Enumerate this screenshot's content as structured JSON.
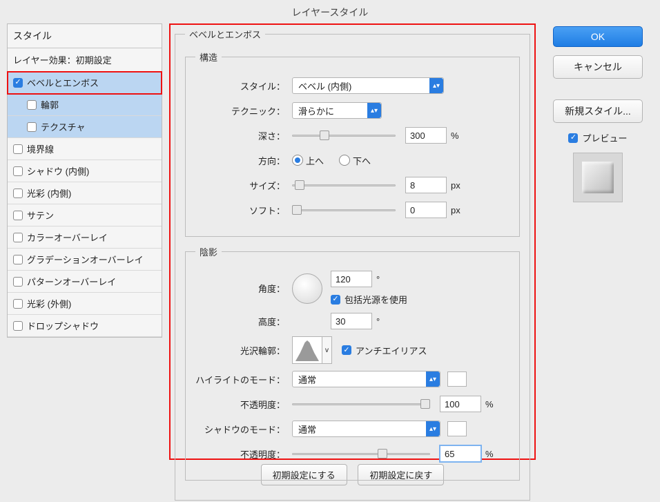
{
  "title": "レイヤースタイル",
  "left": {
    "header": "スタイル",
    "sub": "レイヤー効果：初期設定",
    "items": [
      {
        "label": "ベベルとエンボス",
        "checked": true,
        "selected": true,
        "highlight": true
      },
      {
        "label": "輪郭",
        "checked": false,
        "selected": true,
        "indent": true
      },
      {
        "label": "テクスチャ",
        "checked": false,
        "selected": true,
        "indent": true
      },
      {
        "label": "境界線",
        "checked": false
      },
      {
        "label": "シャドウ (内側)",
        "checked": false
      },
      {
        "label": "光彩 (内側)",
        "checked": false
      },
      {
        "label": "サテン",
        "checked": false
      },
      {
        "label": "カラーオーバーレイ",
        "checked": false
      },
      {
        "label": "グラデーションオーバーレイ",
        "checked": false
      },
      {
        "label": "パターンオーバーレイ",
        "checked": false
      },
      {
        "label": "光彩 (外側)",
        "checked": false
      },
      {
        "label": "ドロップシャドウ",
        "checked": false
      }
    ]
  },
  "center": {
    "section_title": "ベベルとエンボス",
    "structure": {
      "legend": "構造",
      "style_label": "スタイル：",
      "style_value": "ベベル (内側)",
      "technique_label": "テクニック：",
      "technique_value": "滑らかに",
      "depth_label": "深さ：",
      "depth_value": "300",
      "depth_unit": "%",
      "direction_label": "方向：",
      "dir_up": "上へ",
      "dir_down": "下へ",
      "size_label": "サイズ：",
      "size_value": "8",
      "size_unit": "px",
      "soft_label": "ソフト：",
      "soft_value": "0",
      "soft_unit": "px"
    },
    "shading": {
      "legend": "陰影",
      "angle_label": "角度：",
      "angle_value": "120",
      "deg": "°",
      "global_light": "包括光源を使用",
      "altitude_label": "高度：",
      "altitude_value": "30",
      "contour_label": "光沢輪郭：",
      "contour_car": "v",
      "antialias": "アンチエイリアス",
      "highlight_mode_label": "ハイライトのモード：",
      "highlight_mode_value": "通常",
      "highlight_op_label": "不透明度：",
      "highlight_op_value": "100",
      "pct": "%",
      "shadow_mode_label": "シャドウのモード：",
      "shadow_mode_value": "通常",
      "shadow_op_label": "不透明度：",
      "shadow_op_value": "65"
    },
    "reset_default": "初期設定にする",
    "revert_default": "初期設定に戻す"
  },
  "right": {
    "ok": "OK",
    "cancel": "キャンセル",
    "new_style": "新規スタイル...",
    "preview": "プレビュー"
  }
}
